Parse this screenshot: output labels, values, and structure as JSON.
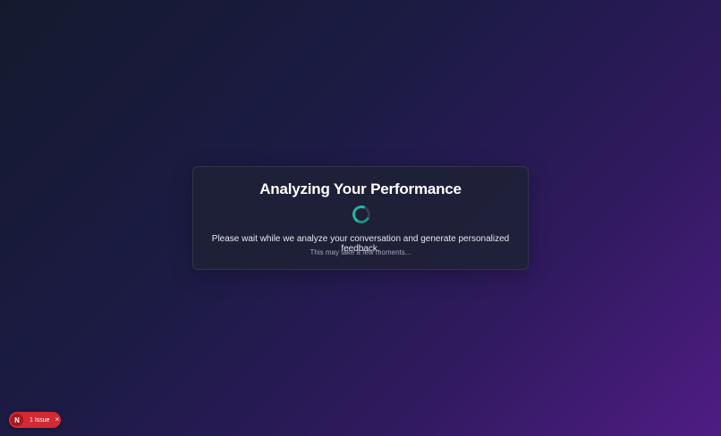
{
  "loading": {
    "title": "Analyzing Your Performance",
    "message": "Please wait while we analyze your conversation and generate personalized feedback.",
    "submessage": "This may take a few moments...",
    "spinner_color": "#26b6a4"
  },
  "dev_overlay": {
    "logo_letter": "N",
    "issues_label": "1 Issue",
    "close_glyph": "×",
    "pill_color": "#d12a33"
  }
}
